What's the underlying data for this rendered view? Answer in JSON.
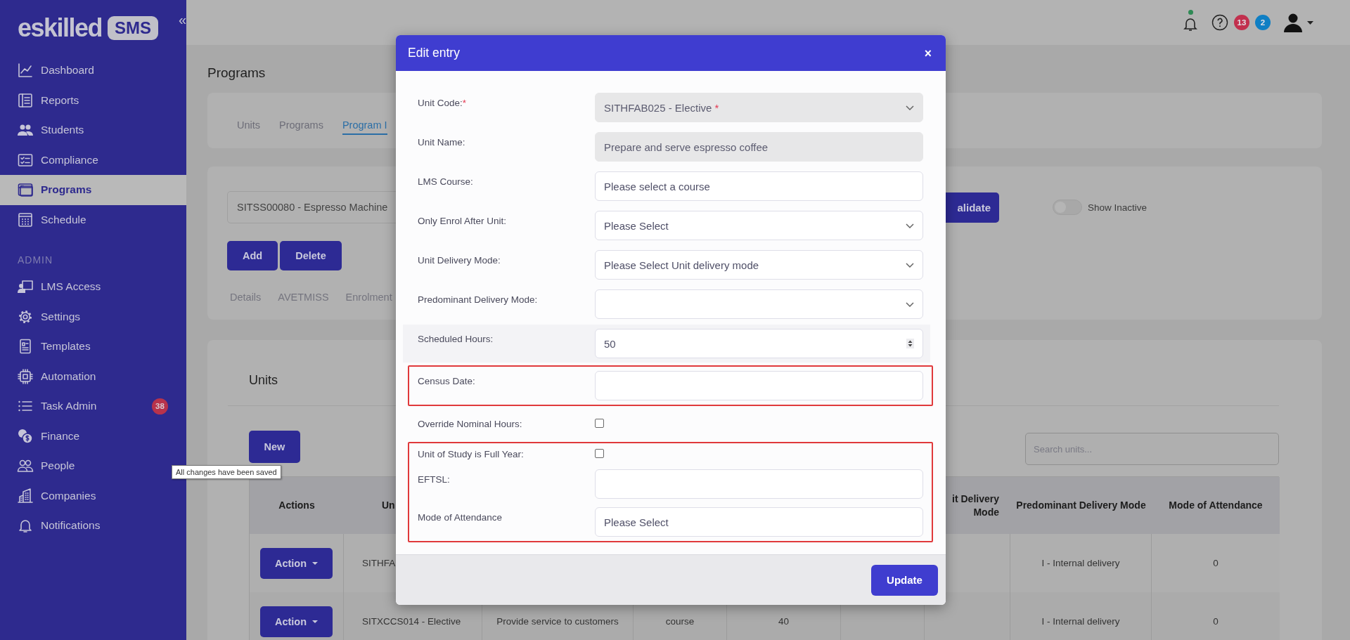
{
  "sidebar": {
    "logo_text": "eskilled",
    "logo_badge": "SMS",
    "collapse": "«",
    "items": [
      {
        "label": "Dashboard",
        "selected": false
      },
      {
        "label": "Reports",
        "selected": false
      },
      {
        "label": "Students",
        "selected": false
      },
      {
        "label": "Compliance",
        "selected": false
      },
      {
        "label": "Programs",
        "selected": true
      },
      {
        "label": "Schedule",
        "selected": false
      }
    ],
    "section_label": "ADMIN",
    "admin_items": [
      {
        "label": "LMS Access",
        "selected": false
      },
      {
        "label": "Settings",
        "selected": false
      },
      {
        "label": "Templates",
        "selected": false
      },
      {
        "label": "Automation",
        "selected": false
      },
      {
        "label": "Task Admin",
        "selected": false,
        "badge": "38"
      },
      {
        "label": "Finance",
        "selected": false
      },
      {
        "label": "People",
        "selected": false
      },
      {
        "label": "Companies",
        "selected": false
      },
      {
        "label": "Notifications",
        "selected": false
      }
    ]
  },
  "topbar": {
    "bell_dot": true,
    "counters": [
      {
        "count": "13",
        "color": "#c2304e"
      },
      {
        "count": "2",
        "color": "#0f7fc4"
      }
    ]
  },
  "page": {
    "title": "Programs",
    "tabs": [
      {
        "label": "Units",
        "selected": false
      },
      {
        "label": "Programs",
        "selected": false
      },
      {
        "label": "Program I",
        "selected": true
      }
    ],
    "program_select": {
      "value": "SITSS00080 - Espresso Machine"
    },
    "validate_button": "alidate",
    "show_inactive": {
      "label": "Show Inactive",
      "on": false
    },
    "buttons": [
      "Add",
      "Delete"
    ],
    "subtabs": [
      "Details",
      "AVETMISS",
      "Enrolment"
    ],
    "units": {
      "heading": "Units",
      "new_button": "New",
      "search": {
        "placeholder": "Search units..."
      },
      "columns": [
        "Actions",
        "Un",
        "",
        "",
        "",
        "",
        "it Delivery Mode",
        "Predominant Delivery Mode",
        "Mode of Attendance"
      ],
      "rows": [
        {
          "cells": [
            "Action",
            "SITHFA",
            "",
            "",
            "",
            "",
            "",
            "I - Internal delivery",
            "0"
          ]
        },
        {
          "cells": [
            "Action",
            "SITXCCS014 - Elective",
            "Provide service to customers",
            "course",
            "40",
            "",
            "",
            "I - Internal delivery",
            "0"
          ]
        }
      ]
    }
  },
  "tooltip": "All changes have been saved",
  "modal": {
    "title": "Edit entry",
    "close": "×",
    "submit": "Update",
    "sections": [
      {
        "highlighted": false,
        "fields": [
          {
            "kind": "select",
            "label": "Unit Code:",
            "label_mark": "*",
            "value": "SITHFAB025 - Elective",
            "value_mark": "*",
            "disabled": true,
            "hovered": false
          },
          {
            "kind": "text",
            "label": "Unit Name:",
            "value": "Prepare and serve espresso coffee",
            "disabled": true,
            "hovered": false
          },
          {
            "kind": "text",
            "label": "LMS Course:",
            "value": "Please select a course",
            "disabled": false,
            "hovered": false
          },
          {
            "kind": "select",
            "label": "Only Enrol After Unit:",
            "value": "Please Select",
            "disabled": false,
            "hovered": false
          },
          {
            "kind": "select",
            "label": "Unit Delivery Mode:",
            "value": "Please Select Unit delivery mode",
            "disabled": false,
            "hovered": false
          },
          {
            "kind": "select",
            "label": "Predominant Delivery Mode:",
            "disabled": false,
            "hovered": false
          },
          {
            "kind": "number",
            "label": "Scheduled Hours:",
            "value": "50",
            "disabled": false,
            "hovered": true
          }
        ]
      },
      {
        "highlighted": true,
        "fields": [
          {
            "kind": "text",
            "label": "Census Date:",
            "disabled": false,
            "hovered": false
          }
        ]
      },
      {
        "highlighted": false,
        "fields": [
          {
            "kind": "checkbox",
            "label": "Override Nominal Hours:",
            "checked": false,
            "disabled": false,
            "hovered": false
          }
        ]
      },
      {
        "highlighted": true,
        "fields": [
          {
            "kind": "checkbox",
            "label": "Unit of Study is Full Year:",
            "checked": false,
            "disabled": false,
            "hovered": false
          },
          {
            "kind": "text",
            "label": "EFTSL:",
            "disabled": false,
            "hovered": false
          },
          {
            "kind": "text",
            "label": "Mode of Attendance",
            "value": "Please Select",
            "disabled": false,
            "hovered": false
          }
        ]
      }
    ]
  }
}
